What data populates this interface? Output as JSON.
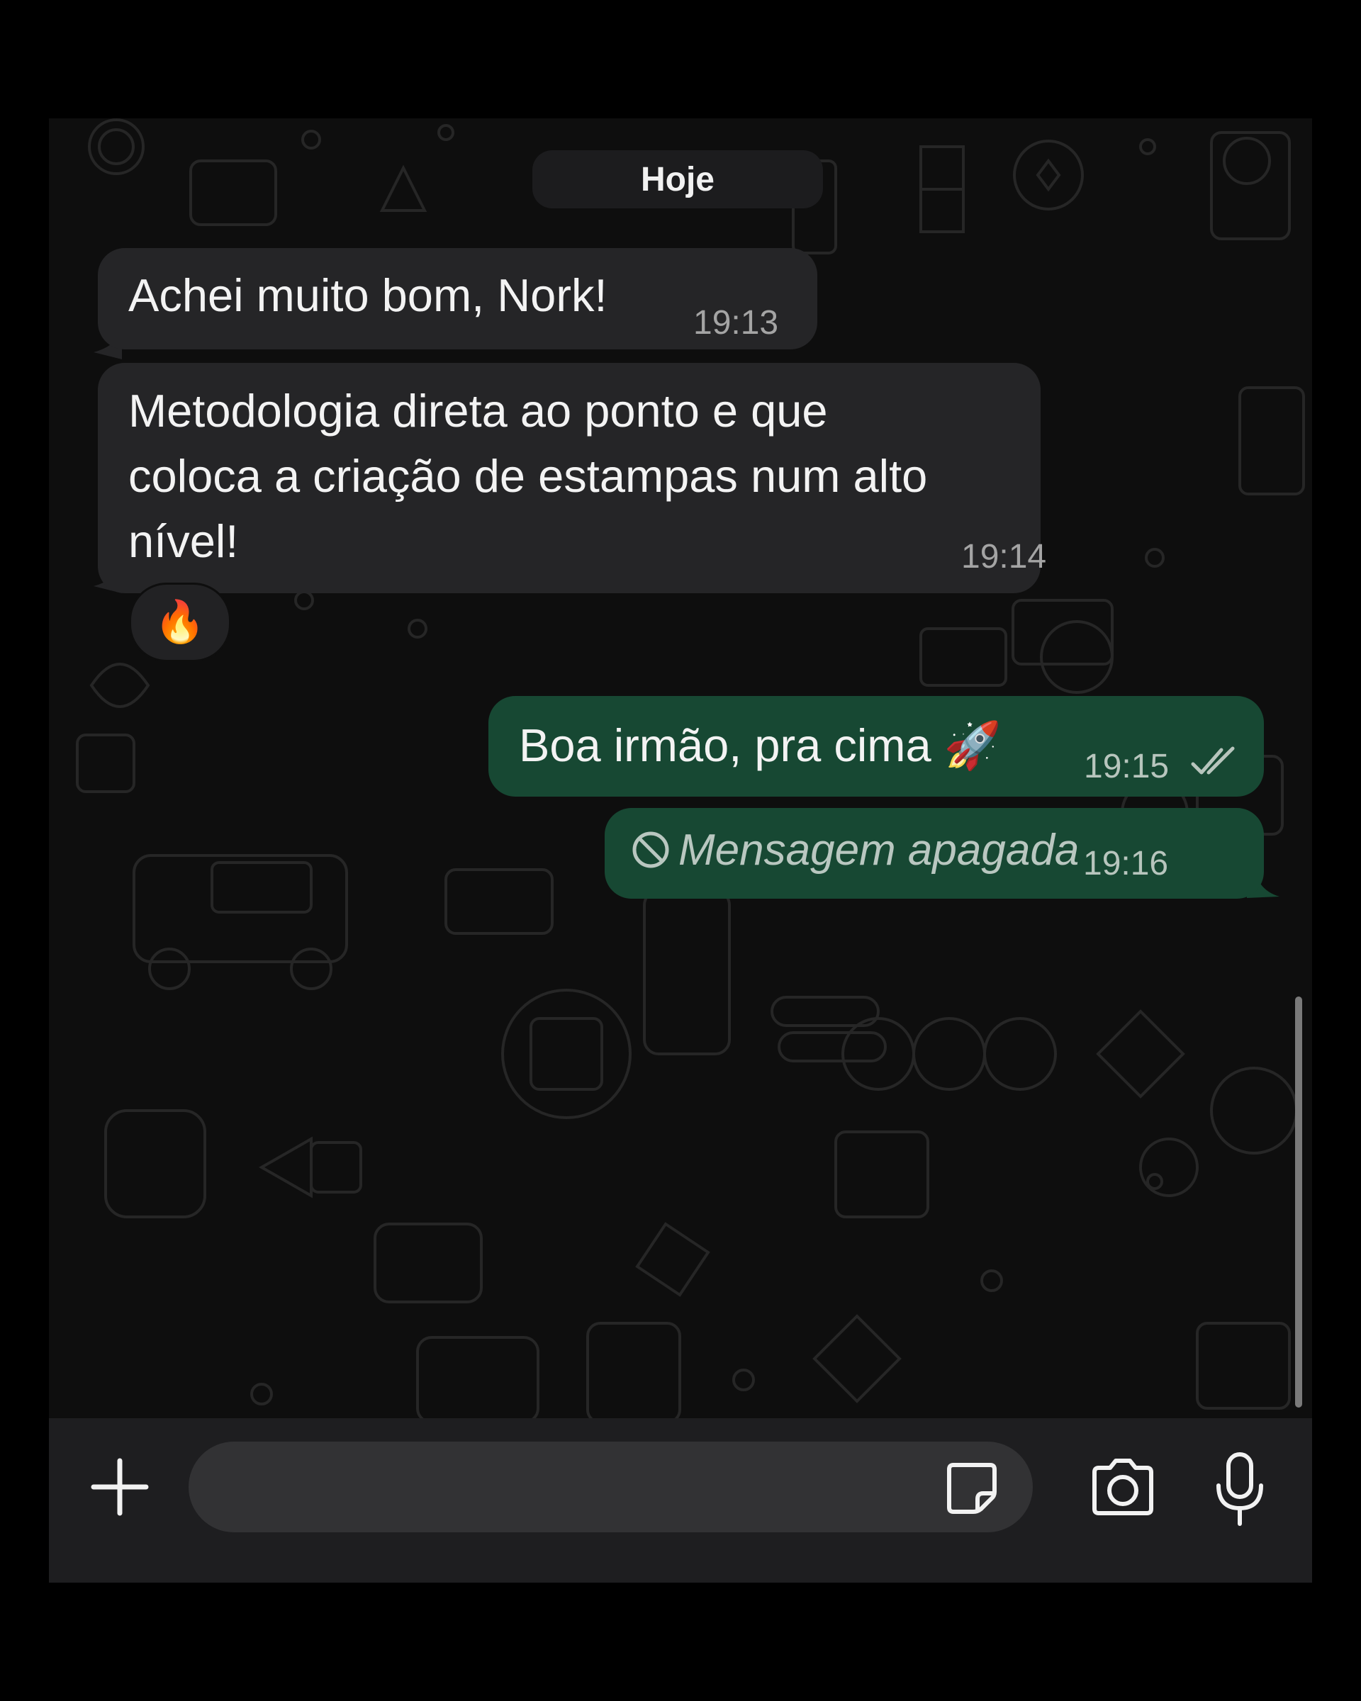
{
  "chat": {
    "date_label": "Hoje",
    "messages": [
      {
        "direction": "in",
        "text": "Achei muito bom, Nork!",
        "time": "19:13"
      },
      {
        "direction": "in",
        "lines": [
          "Metodologia direta ao ponto e que",
          "coloca a criação de estampas num alto",
          "nível!"
        ],
        "time": "19:14",
        "reaction": "🔥"
      },
      {
        "direction": "out",
        "text": "Boa irmão, pra cima 🚀",
        "time": "19:15",
        "status": "read-double-check"
      },
      {
        "direction": "out",
        "deleted": true,
        "text": "Mensagem apagada",
        "time": "19:16"
      }
    ]
  },
  "composer": {
    "input_value": "",
    "icons": [
      "plus-icon",
      "sticker-icon",
      "camera-icon",
      "microphone-icon"
    ]
  },
  "colors": {
    "incoming_bubble": "#252527",
    "outgoing_bubble": "#174833",
    "chat_background": "#0e0e0e"
  }
}
